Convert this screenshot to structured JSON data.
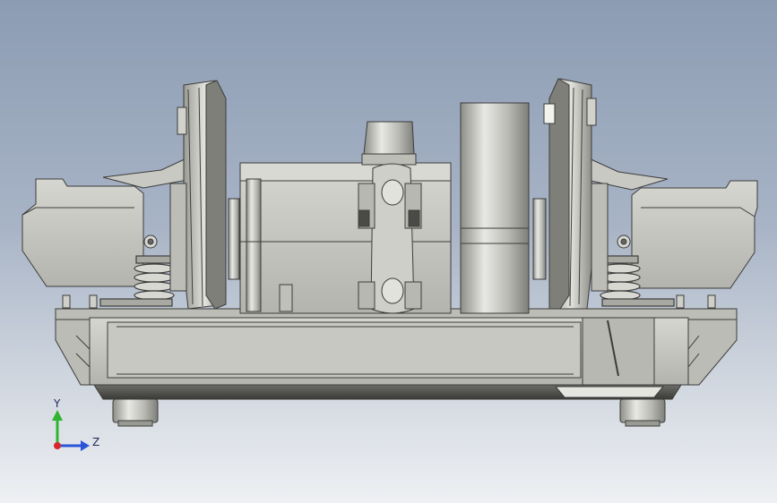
{
  "viewport": {
    "background_top": "#8c9cb3",
    "background_bottom": "#eef0f3",
    "model_color": "#c9c9c4",
    "edge_color": "#3c3c3a"
  },
  "triad": {
    "y_label": "Y",
    "z_label": "Z",
    "y_axis_color": "#2fb52f",
    "z_axis_color": "#2a55d8",
    "x_origin_color": "#d8262a"
  }
}
